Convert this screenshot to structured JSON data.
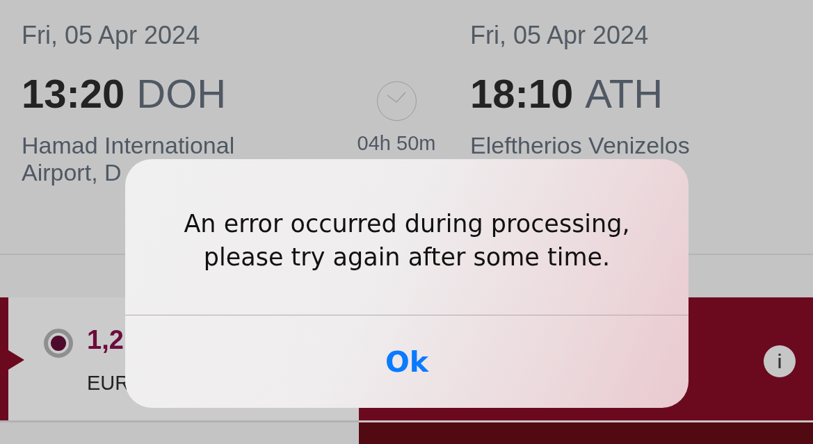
{
  "flight": {
    "departure": {
      "date": "Fri, 05 Apr 2024",
      "time": "13:20",
      "airport_code": "DOH",
      "airport_name": "Hamad International Airport, D"
    },
    "duration": "04h 50m",
    "arrival": {
      "date": "Fri, 05 Apr 2024",
      "time": "18:10",
      "airport_code": "ATH",
      "airport_name": "Eleftherios Venizelos"
    }
  },
  "fares": [
    {
      "price": "1,2",
      "currency": "EUR",
      "selected": true
    }
  ],
  "dialog": {
    "message": "An error occurred during processing, please try again after some time.",
    "buttons": [
      "Ok"
    ]
  }
}
